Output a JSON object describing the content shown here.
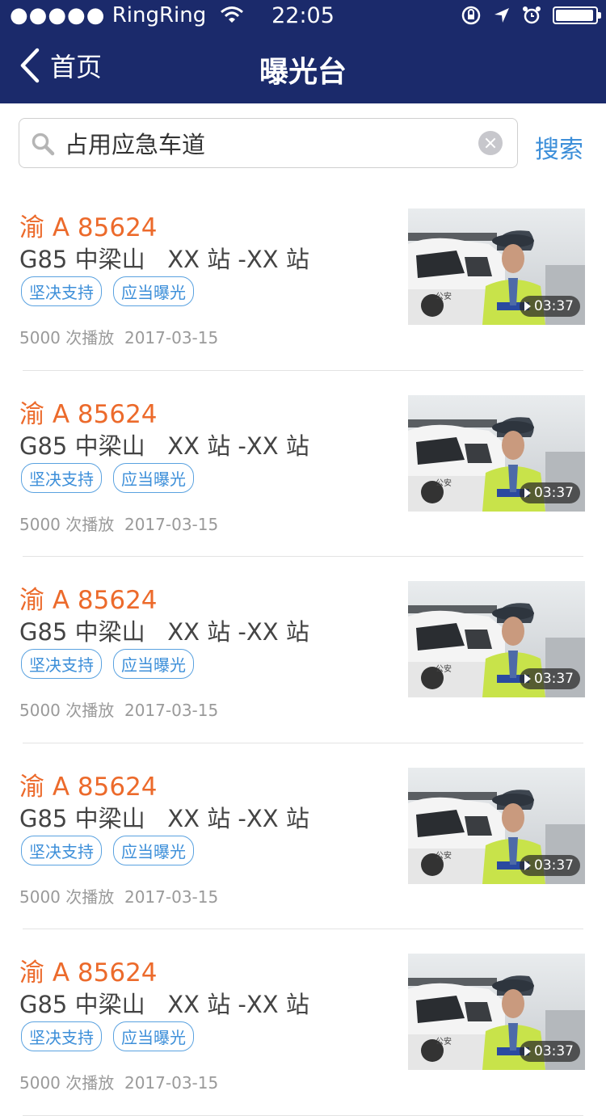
{
  "status_bar": {
    "signal_dots": "●●●●●",
    "carrier": "RingRing",
    "time": "22:05",
    "battery_level": 0.95
  },
  "nav": {
    "back_label": "首页",
    "title": "曝光台"
  },
  "search": {
    "value": "占用应急车道",
    "button_label": "搜索"
  },
  "items": [
    {
      "plate": "渝 A 85624",
      "route": "G85 中梁山   XX 站 -XX 站",
      "tags": [
        "坚决支持",
        "应当曝光"
      ],
      "plays": "5000 次播放",
      "date": "2017-03-15",
      "duration": "03:37"
    },
    {
      "plate": "渝 A 85624",
      "route": "G85 中梁山   XX 站 -XX 站",
      "tags": [
        "坚决支持",
        "应当曝光"
      ],
      "plays": "5000 次播放",
      "date": "2017-03-15",
      "duration": "03:37"
    },
    {
      "plate": "渝 A 85624",
      "route": "G85 中梁山   XX 站 -XX 站",
      "tags": [
        "坚决支持",
        "应当曝光"
      ],
      "plays": "5000 次播放",
      "date": "2017-03-15",
      "duration": "03:37"
    },
    {
      "plate": "渝 A 85624",
      "route": "G85 中梁山   XX 站 -XX 站",
      "tags": [
        "坚决支持",
        "应当曝光"
      ],
      "plays": "5000 次播放",
      "date": "2017-03-15",
      "duration": "03:37"
    },
    {
      "plate": "渝 A 85624",
      "route": "G85 中梁山   XX 站 -XX 站",
      "tags": [
        "坚决支持",
        "应当曝光"
      ],
      "plays": "5000 次播放",
      "date": "2017-03-15",
      "duration": "03:37"
    }
  ],
  "colors": {
    "nav_bg": "#1b2a6b",
    "plate": "#ec6a2b",
    "accent": "#3d8fd9"
  }
}
